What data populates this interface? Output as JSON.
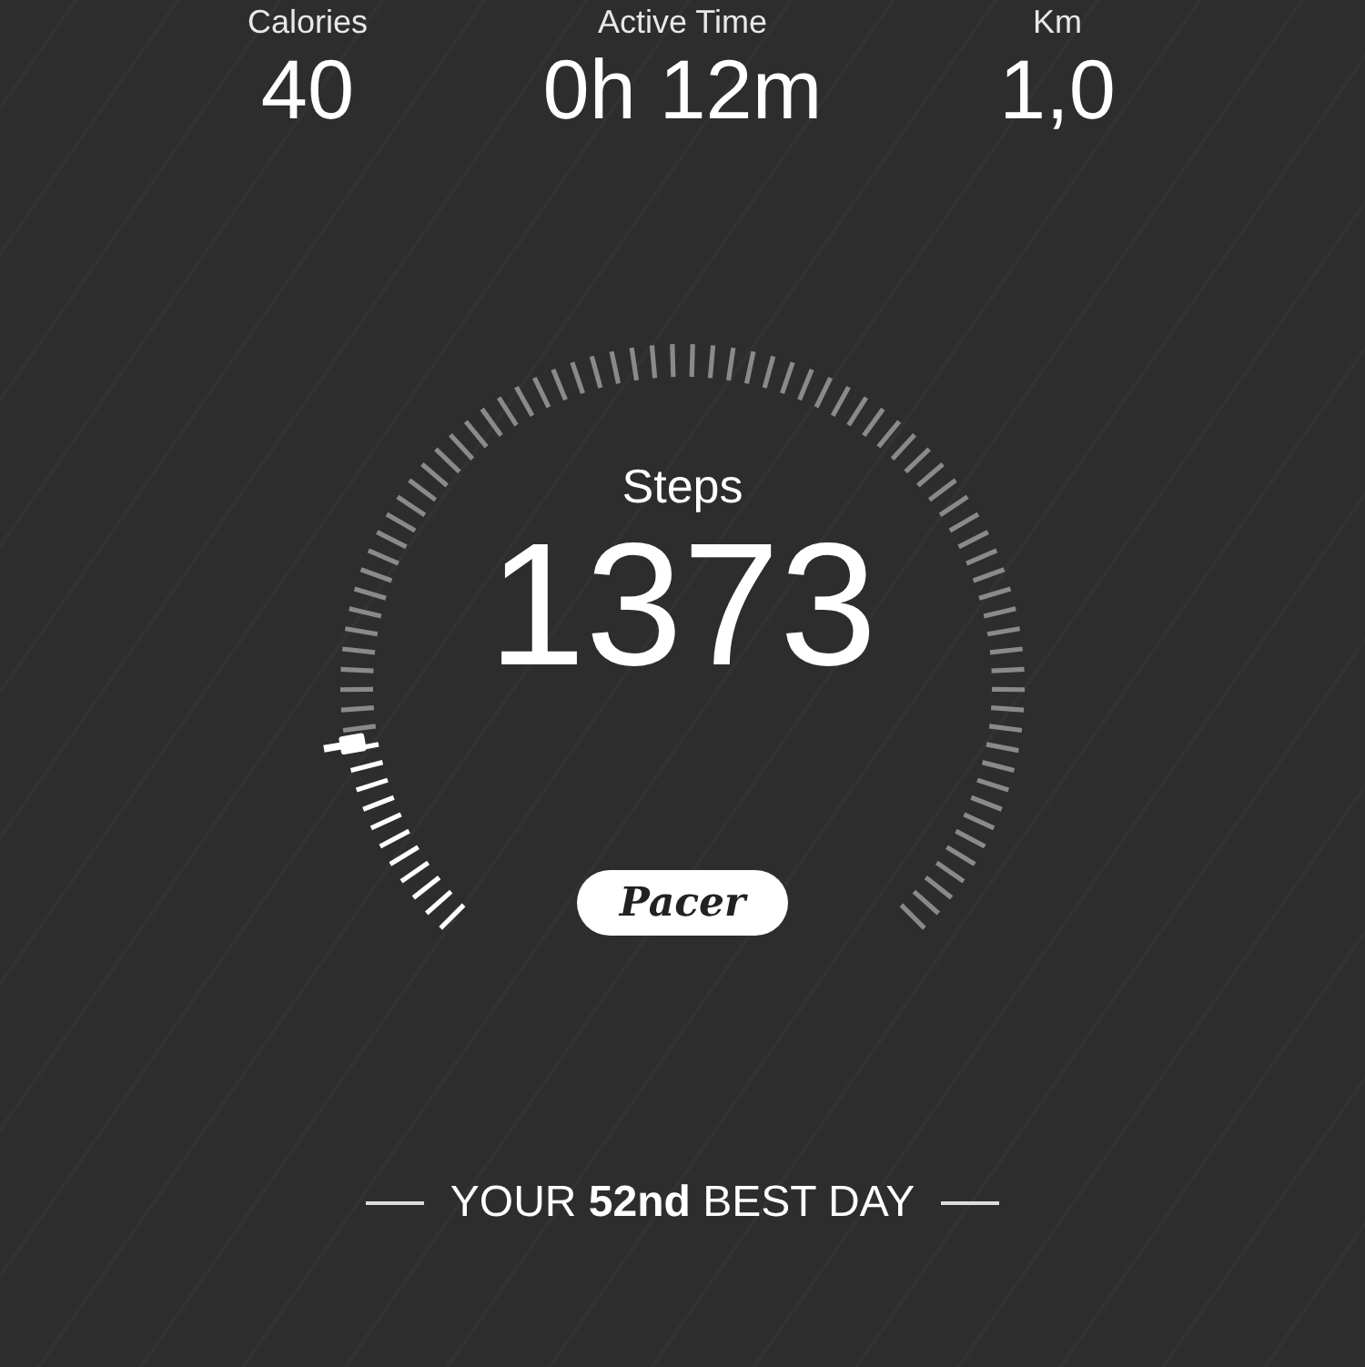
{
  "stats": [
    {
      "label": "Calories",
      "value": "40"
    },
    {
      "label": "Active Time",
      "value": "0h 12m"
    },
    {
      "label": "Km",
      "value": "1,0"
    }
  ],
  "gauge": {
    "label": "Steps",
    "value": "1373"
  },
  "badge": "Pacer",
  "best_day": "YOUR **52nd** BEST DAY"
}
